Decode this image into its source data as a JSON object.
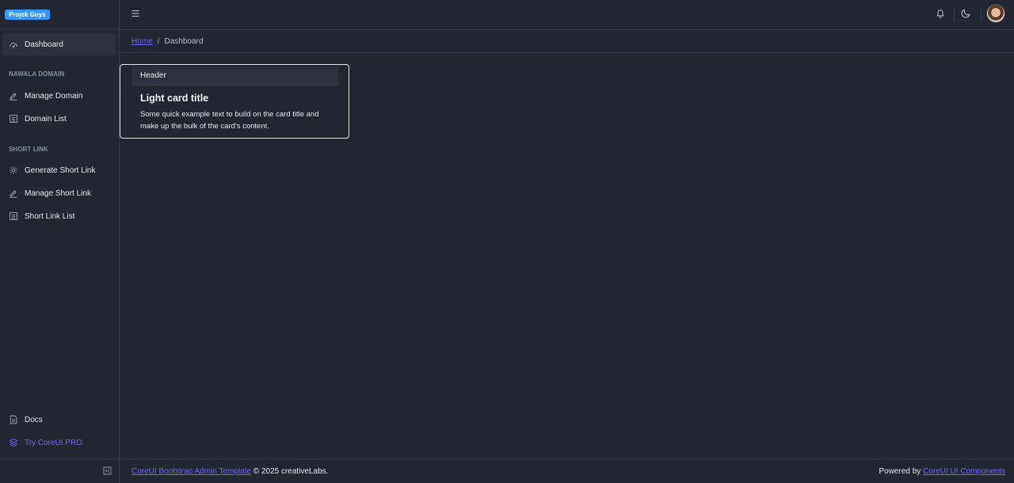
{
  "brand": {
    "label": "Projek Guys"
  },
  "sidebar": {
    "items": [
      {
        "label": "Dashboard",
        "icon": "speedometer-icon"
      },
      {
        "section": "NAWALA DOMAIN"
      },
      {
        "label": "Manage Domain",
        "icon": "pencil-icon"
      },
      {
        "label": "Domain List",
        "icon": "list-icon"
      },
      {
        "section": "SHORT LINK"
      },
      {
        "label": "Generate Short Link",
        "icon": "settings-icon"
      },
      {
        "label": "Manage Short Link",
        "icon": "pencil-icon"
      },
      {
        "label": "Short Link List",
        "icon": "list-icon"
      }
    ],
    "bottom": [
      {
        "label": "Docs",
        "icon": "document-icon"
      },
      {
        "label": "Try CoreUI PRO",
        "icon": "layers-icon"
      }
    ]
  },
  "breadcrumb": {
    "home": "Home",
    "separator": "/",
    "current": "Dashboard"
  },
  "card": {
    "header": "Header",
    "title": "Light card title",
    "text": "Some quick example text to build on the card title and make up the bulk of the card's content."
  },
  "footer": {
    "left_link": "CoreUI Bootstrap Admin Template",
    "left_text": "© 2025 creativeLabs.",
    "right_text": "Powered by",
    "right_link": "CoreUI UI Components"
  },
  "colors": {
    "background": "#212631",
    "accent": "#6c63ff",
    "brand": "#3399ff"
  }
}
